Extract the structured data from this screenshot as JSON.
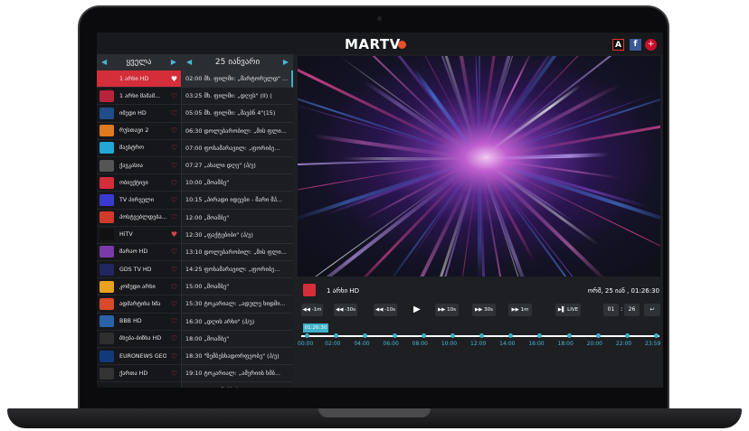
{
  "app": {
    "logo": "MARTV",
    "social": [
      "A",
      "f",
      "+"
    ]
  },
  "colors": {
    "accent": "#3db1c8",
    "brand_red": "#d42e3a",
    "logo_dot": "#e8502a"
  },
  "channels_header": "ყველა",
  "epg_header": "25 იანვარი",
  "channels": [
    {
      "name": "1 არხი HD",
      "logo_color": "#d42e3a",
      "fav": true
    },
    {
      "name": "1 არხი მამამ...",
      "logo_color": "#b8233d",
      "fav": false
    },
    {
      "name": "იმედი HD",
      "logo_color": "#1f4d8a",
      "fav": false
    },
    {
      "name": "რუსთავი 2",
      "logo_color": "#e07a1f",
      "fav": false
    },
    {
      "name": "მაესტრო",
      "logo_color": "#23a7d6",
      "fav": false
    },
    {
      "name": "ქავკასია",
      "logo_color": "#555555",
      "fav": false
    },
    {
      "name": "ობიექტივი",
      "logo_color": "#d42e3a",
      "fav": false
    },
    {
      "name": "TV პირველი",
      "logo_color": "#3a3ad0",
      "fav": false
    },
    {
      "name": "პოსტვებლდება...",
      "logo_color": "#d0392b",
      "fav": false
    },
    {
      "name": "HiTV",
      "logo_color": "#111111",
      "fav": true
    },
    {
      "name": "მარაო HD",
      "logo_color": "#7b3aa8",
      "fav": false
    },
    {
      "name": "GDS TV HD",
      "logo_color": "#22265e",
      "fav": false
    },
    {
      "name": "კომედი არხი",
      "logo_color": "#e8a21f",
      "fav": false
    },
    {
      "name": "ადმარტინა ხმა",
      "logo_color": "#d84a2a",
      "fav": false
    },
    {
      "name": "BBB HD",
      "logo_color": "#2a63a8",
      "fav": false
    },
    {
      "name": "ბნება-ბიზნა HD",
      "logo_color": "#2f2f2f",
      "fav": false
    },
    {
      "name": "EURONEWS GEO...",
      "logo_color": "#123a7a",
      "fav": false
    },
    {
      "name": "ქართა HD",
      "logo_color": "#333333",
      "fav": false
    }
  ],
  "epg": [
    {
      "text": "02:00 მხ. ფილმი: „მარტორულდ\" ..."
    },
    {
      "text": "03:25 მხ. ფილმი: „დღეს\" (II) ("
    },
    {
      "text": "05:05 მხ. ფილმი: „შავბნ 4\"(15)"
    },
    {
      "text": "06:30 დოლუბარობილ: „მის ფლი..."
    },
    {
      "text": "07:00 ფოსამარავილ: „ფორიბე..."
    },
    {
      "text": "07:27 „ახალი დღე\" (პ/ე)"
    },
    {
      "text": "10:00 „მოამბე\""
    },
    {
      "text": "10:15 „პირადი იდეები - მარი მპ..."
    },
    {
      "text": "12:00 „მოამბე\""
    },
    {
      "text": "12:30 „ფაქტებიბი\" (პ/ე)"
    },
    {
      "text": "13:10 დოლუბარობილ: „მის ფლი..."
    },
    {
      "text": "14:25 ფოსამარავილ: „ფორიბე..."
    },
    {
      "text": "15:00 „მოამბე\""
    },
    {
      "text": "15:30 ტოკარიალ: „ადულე ხიდმი..."
    },
    {
      "text": "16:30 „დღის არხი\" (პ/ე)"
    },
    {
      "text": "18:00 „მოამბე\""
    },
    {
      "text": "18:30 \"ზემბესხადორფეობე\" (პ/ე)"
    },
    {
      "text": "19:10 ტოკარიალ: „ამერიის ხმბ..."
    },
    {
      "text": "19:55 „ფილმიპბიბე\""
    }
  ],
  "now_playing": {
    "channel": "1 არხი HD",
    "datetime": "ორშ, 25 იან , 01:26:30"
  },
  "controls": {
    "buttons": [
      "◀◀ -1m",
      "◀◀ -30s",
      "◀◀ -10s",
      "▶▶ 10s",
      "▶▶ 30s",
      "▶▶ 1m",
      "▶▌ LIVE"
    ],
    "play": "▶",
    "hour": "01",
    "minute": "26",
    "back": "↩"
  },
  "timeline": {
    "current": "01:26:30",
    "labels": [
      "00:00",
      "02:00",
      "04:00",
      "06:00",
      "08:00",
      "10:00",
      "12:00",
      "14:00",
      "16:00",
      "18:00",
      "20:00",
      "22:00",
      "23:59"
    ]
  }
}
